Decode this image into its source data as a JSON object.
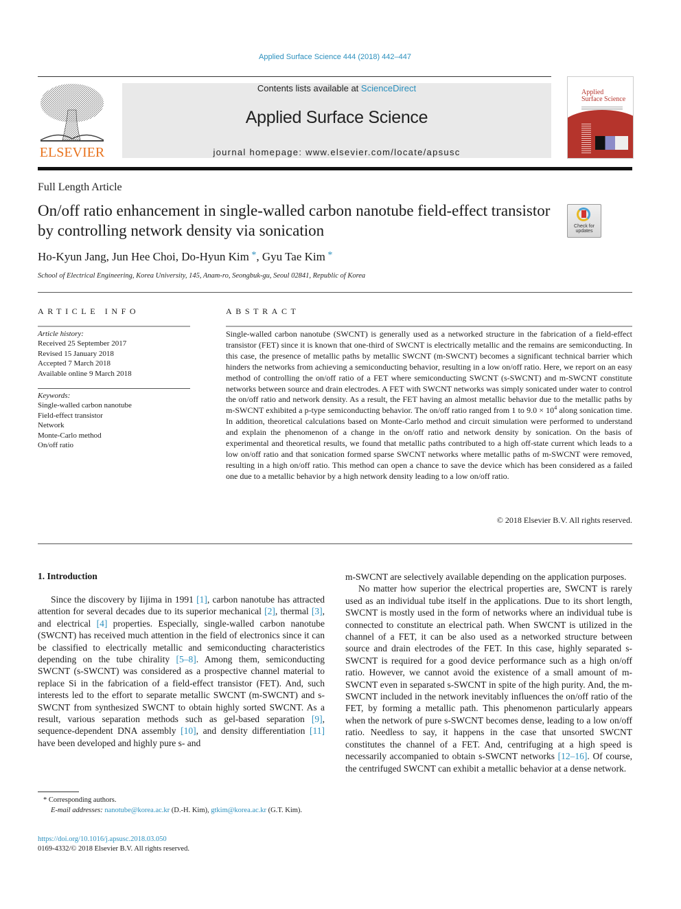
{
  "header": {
    "citation": "Applied Surface Science 444 (2018) 442–447",
    "publisher_logo_text": "ELSEVIER",
    "contents_prefix": "Contents lists available at ",
    "contents_link": "ScienceDirect",
    "journal_name": "Applied Surface Science",
    "homepage": "journal homepage: www.elsevier.com/locate/apsusc",
    "cover_title_line1": "Applied",
    "cover_title_line2": "Surface Science"
  },
  "article": {
    "type": "Full Length Article",
    "title": "On/off ratio enhancement in single-walled carbon nanotube field-effect transistor by controlling network density via sonication",
    "check_updates_line1": "Check for",
    "check_updates_line2": "updates",
    "authors": [
      {
        "name": "Ho-Kyun Jang",
        "corresponding": false
      },
      {
        "name": "Jun Hee Choi",
        "corresponding": false
      },
      {
        "name": "Do-Hyun Kim",
        "corresponding": true
      },
      {
        "name": "Gyu Tae Kim",
        "corresponding": true
      }
    ],
    "author_sep": ", ",
    "star": "*",
    "affiliation": "School of Electrical Engineering, Korea University, 145, Anam-ro, Seongbuk-gu, Seoul 02841, Republic of Korea"
  },
  "article_info": {
    "heading": "ARTICLE INFO",
    "history_label": "Article history:",
    "history": [
      "Received 25 September 2017",
      "Revised 15 January 2018",
      "Accepted 7 March 2018",
      "Available online 9 March 2018"
    ],
    "keywords_label": "Keywords:",
    "keywords": [
      "Single-walled carbon nanotube",
      "Field-effect transistor",
      "Network",
      "Monte-Carlo method",
      "On/off ratio"
    ]
  },
  "abstract": {
    "heading": "ABSTRACT",
    "text_before_sup": "Single-walled carbon nanotube (SWCNT) is generally used as a networked structure in the fabrication of a field-effect transistor (FET) since it is known that one-third of SWCNT is electrically metallic and the remains are semiconducting. In this case, the presence of metallic paths by metallic SWCNT (m-SWCNT) becomes a significant technical barrier which hinders the networks from achieving a semiconducting behavior, resulting in a low on/off ratio. Here, we report on an easy method of controlling the on/off ratio of a FET where semiconducting SWCNT (s-SWCNT) and m-SWCNT constitute networks between source and drain electrodes. A FET with SWCNT networks was simply sonicated under water to control the on/off ratio and network density. As a result, the FET having an almost metallic behavior due to the metallic paths by m-SWCNT exhibited a p-type semiconducting behavior. The on/off ratio ranged from 1 to 9.0 × 10",
    "sup": "4",
    "text_after_sup": " along sonication time. In addition, theoretical calculations based on Monte-Carlo method and circuit simulation were performed to understand and explain the phenomenon of a change in the on/off ratio and network density by sonication. On the basis of experimental and theoretical results, we found that metallic paths contributed to a high off-state current which leads to a low on/off ratio and that sonication formed sparse SWCNT networks where metallic paths of m-SWCNT were removed, resulting in a high on/off ratio. This method can open a chance to save the device which has been considered as a failed one due to a metallic behavior by a high network density leading to a low on/off ratio.",
    "copyright": "© 2018 Elsevier B.V. All rights reserved."
  },
  "body": {
    "intro_heading": "1. Introduction",
    "p1": [
      {
        "t": "Since the discovery by Iijima in 1991 "
      },
      {
        "t": "[1]",
        "ref": true
      },
      {
        "t": ", carbon nanotube has attracted attention for several decades due to its superior mechanical "
      },
      {
        "t": "[2]",
        "ref": true
      },
      {
        "t": ", thermal "
      },
      {
        "t": "[3]",
        "ref": true
      },
      {
        "t": ", and electrical "
      },
      {
        "t": "[4]",
        "ref": true
      },
      {
        "t": " properties. Especially, single-walled carbon nanotube (SWCNT) has received much attention in the field of electronics since it can be classified to electrically metallic and semiconducting characteristics depending on the tube chirality "
      },
      {
        "t": "[5–8]",
        "ref": true
      },
      {
        "t": ". Among them, semiconducting SWCNT (s-SWCNT) was considered as a prospective channel material to replace Si in the fabrication of a field-effect transistor (FET). And, such interests led to the effort to separate metallic SWCNT (m-SWCNT) and s-SWCNT from synthesized SWCNT to obtain highly sorted SWCNT. As a result, various separation methods such as gel-based separation "
      },
      {
        "t": "[9]",
        "ref": true
      },
      {
        "t": ", sequence-dependent DNA assembly "
      },
      {
        "t": "[10]",
        "ref": true
      },
      {
        "t": ", and density differentiation "
      },
      {
        "t": "[11]",
        "ref": true
      },
      {
        "t": " have been developed and highly pure s- and"
      }
    ],
    "p1_cont": "m-SWCNT are selectively available depending on the application purposes.",
    "p2": [
      {
        "t": "No matter how superior the electrical properties are, SWCNT is rarely used as an individual tube itself in the applications. Due to its short length, SWCNT is mostly used in the form of networks where an individual tube is connected to constitute an electrical path. When SWCNT is utilized in the channel of a FET, it can be also used as a networked structure between source and drain electrodes of the FET. In this case, highly separated s-SWCNT is required for a good device performance such as a high on/off ratio. However, we cannot avoid the existence of a small amount of m-SWCNT even in separated s-SWCNT in spite of the high purity. And, the m-SWCNT included in the network inevitably influences the on/off ratio of the FET, by forming a metallic path. This phenomenon particularly appears when the network of pure s-SWCNT becomes dense, leading to a low on/off ratio. Needless to say, it happens in the case that unsorted SWCNT constitutes the channel of a FET. And, centrifuging at a high speed is necessarily accompanied to obtain s-SWCNT networks "
      },
      {
        "t": "[12–16]",
        "ref": true
      },
      {
        "t": ". Of course, the centrifuged SWCNT can exhibit a metallic behavior at a dense network."
      }
    ]
  },
  "footer": {
    "corresponding": "* Corresponding authors.",
    "email_label": "E-mail addresses:",
    "email1": "nanotube@korea.ac.kr",
    "email1_who": " (D.-H. Kim), ",
    "email2": "gtkim@korea.ac.kr",
    "email2_who": " (G.T. Kim).",
    "doi": "https://doi.org/10.1016/j.apsusc.2018.03.050",
    "issn": "0169-4332/© 2018 Elsevier B.V. All rights reserved."
  },
  "colors": {
    "link": "#2a8fbd",
    "elsevier_orange": "#e8731e",
    "cover_red": "#b5342c",
    "masthead_gray": "#e9e9e9"
  }
}
